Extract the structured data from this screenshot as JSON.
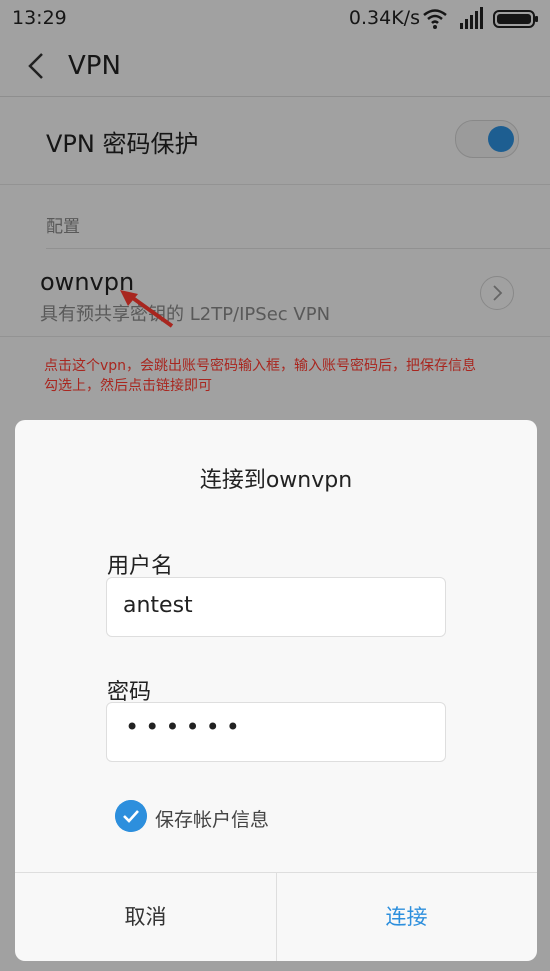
{
  "status_bar": {
    "time": "13:29",
    "network_speed": "0.34K/s",
    "icons": [
      "wifi-icon",
      "signal-icon",
      "battery-icon"
    ]
  },
  "header": {
    "back_icon": "chevron-left-icon",
    "title": "VPN"
  },
  "settings": {
    "password_protection_label": "VPN 密码保护",
    "password_protection_on": true,
    "section_label": "配置",
    "vpn_profile": {
      "name": "ownvpn",
      "description": "具有预共享密钥的 L2TP/IPSec VPN",
      "detail_icon": "chevron-right-circle-icon"
    }
  },
  "annotation": {
    "text": "点击这个vpn，会跳出账号密码输入框，输入账号密码后，把保存信息勾选上，然后点击链接即可",
    "color": "#ff3b30"
  },
  "dialog": {
    "title": "连接到ownvpn",
    "username_label": "用户名",
    "username_value": "antest",
    "password_label": "密码",
    "password_value": "••••••",
    "save_account_label": "保存帐户信息",
    "save_account_checked": true,
    "cancel_label": "取消",
    "connect_label": "连接"
  },
  "colors": {
    "accent": "#2d8fdd",
    "annotation_red": "#ff3b30"
  }
}
